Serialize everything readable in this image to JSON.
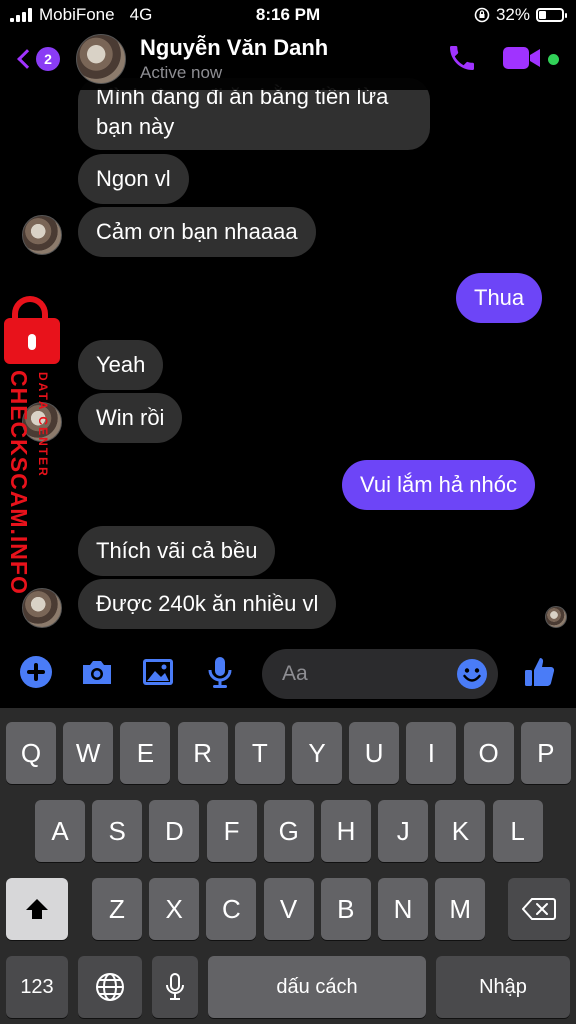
{
  "status_bar": {
    "carrier": "MobiFone",
    "network": "4G",
    "time": "8:16 PM",
    "battery": "32%",
    "battery_level": 0.32
  },
  "header": {
    "unread_count": "2",
    "contact_name": "Nguyễn Văn Danh",
    "status": "Active now",
    "icons": [
      "back-chevron-icon",
      "phone-icon",
      "video-camera-icon"
    ],
    "online_color": "#31d158"
  },
  "messages": [
    {
      "sender": "them",
      "text": "Mình đang đi ăn bằng tiền lừa bạn này"
    },
    {
      "sender": "them",
      "text": "Ngon vl"
    },
    {
      "sender": "them",
      "text": "Cảm ơn bạn nhaaaa"
    },
    {
      "sender": "me",
      "text": "Thua"
    },
    {
      "sender": "them",
      "text": "Yeah"
    },
    {
      "sender": "them",
      "text": "Win rồi"
    },
    {
      "sender": "me",
      "text": "Vui lắm hả nhóc"
    },
    {
      "sender": "them",
      "text": "Thích vãi cả bều"
    },
    {
      "sender": "them",
      "text": "Được 240k ăn nhiều vl"
    }
  ],
  "watermark": {
    "main": "CHECKSCAM.INFO",
    "sub": "DATA CENTER"
  },
  "composer": {
    "placeholder": "Aa",
    "icons": [
      "plus-icon",
      "camera-icon",
      "image-icon",
      "microphone-icon",
      "emoji-icon",
      "thumbs-up-icon"
    ]
  },
  "keyboard": {
    "row1": [
      "Q",
      "W",
      "E",
      "R",
      "T",
      "Y",
      "U",
      "I",
      "O",
      "P"
    ],
    "row2": [
      "A",
      "S",
      "D",
      "F",
      "G",
      "H",
      "J",
      "K",
      "L"
    ],
    "row3": [
      "Z",
      "X",
      "C",
      "V",
      "B",
      "N",
      "M"
    ],
    "numbers_label": "123",
    "space_label": "dấu cách",
    "return_label": "Nhập"
  },
  "colors": {
    "accent": "#a033ff",
    "my_bubble": "#6d45f7",
    "their_bubble": "#303030",
    "composer_icon": "#4a7cf7",
    "watermark": "#e8121b"
  }
}
